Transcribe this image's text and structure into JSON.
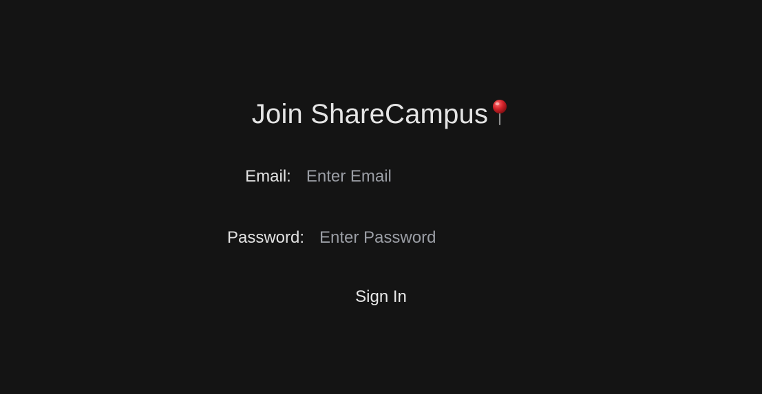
{
  "page": {
    "title": "Join ShareCampus",
    "title_icon": "round-pushpin-icon"
  },
  "form": {
    "email_label": "Email:",
    "email_placeholder": "Enter Email",
    "email_value": "",
    "password_label": "Password:",
    "password_placeholder": "Enter Password",
    "password_value": "",
    "submit_label": "Sign In"
  },
  "colors": {
    "background": "#141414",
    "text": "#e4e4e4",
    "placeholder": "#9b9ea5",
    "pin_red": "#d2232a"
  }
}
